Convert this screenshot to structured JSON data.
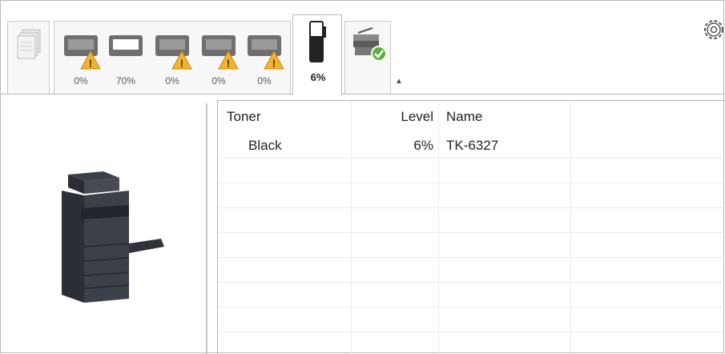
{
  "trays": [
    {
      "label": "0%",
      "warning": true
    },
    {
      "label": "70%",
      "warning": false
    },
    {
      "label": "0%",
      "warning": true
    },
    {
      "label": "0%",
      "warning": true
    },
    {
      "label": "0%",
      "warning": true
    }
  ],
  "toner_tab": {
    "label": "6%",
    "level_fraction": 0.06
  },
  "table": {
    "headers": {
      "toner": "Toner",
      "level": "Level",
      "name": "Name"
    },
    "rows": [
      {
        "toner": "Black",
        "level": "6%",
        "name": "TK-6327"
      }
    ]
  },
  "colors": {
    "warning": "#f2b22f",
    "status_ok": "#5cb13e",
    "toner": "#222222"
  },
  "icons": {
    "paper_stack": "paper-stack-icon",
    "tray": "paper-tray-icon",
    "toner": "toner-cartridge-icon",
    "device_status": "device-status-icon",
    "settings": "gear-icon",
    "collapse": "collapse-icon"
  }
}
